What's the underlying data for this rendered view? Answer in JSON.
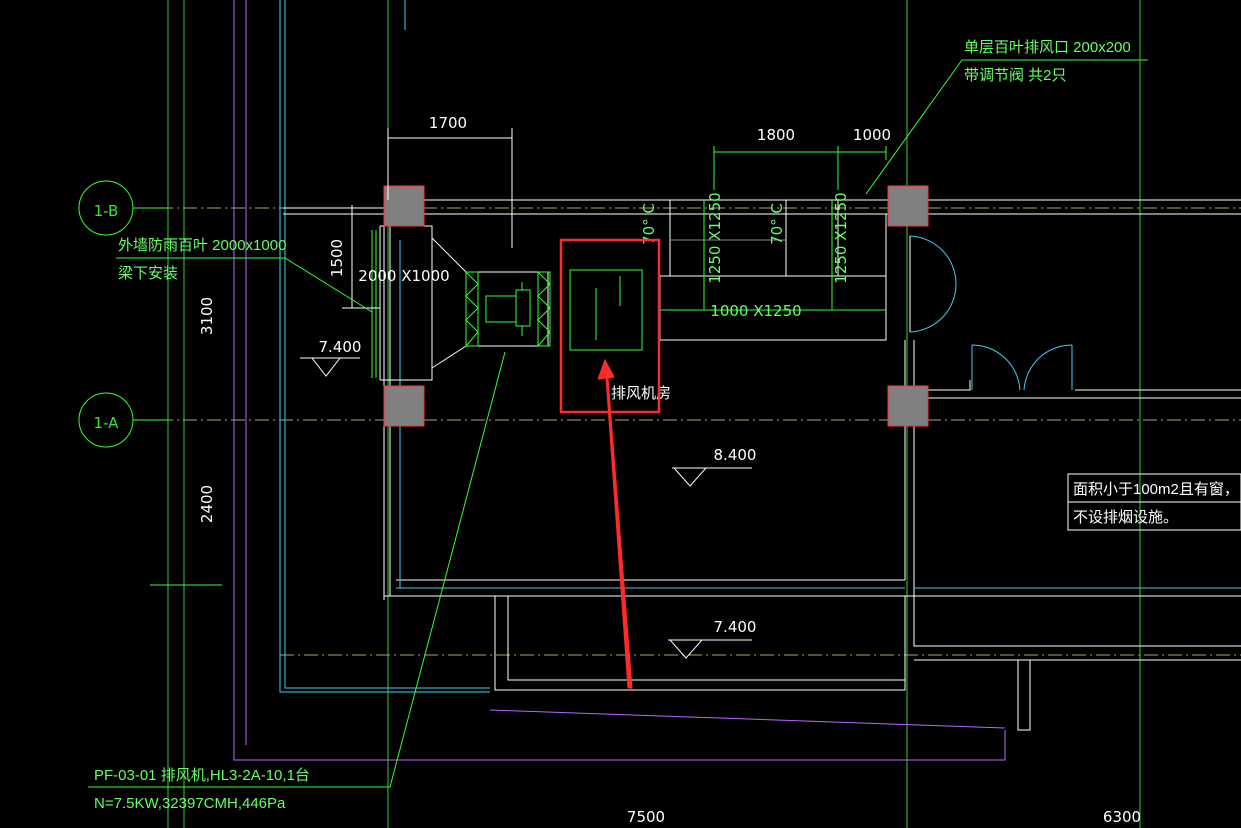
{
  "colors": {
    "background": "#000000",
    "wall_white": "#ffffff",
    "axis_green": "#33ff33",
    "cyan": "#44ccee",
    "magenta": "#bb66ff",
    "column_fill": "#808080",
    "column_border": "#ff3333",
    "highlight_red": "#ff2a2a"
  },
  "grid_axes": {
    "b": "1-B",
    "a": "1-A"
  },
  "dimensions": {
    "top_1700": "1700",
    "top_1800": "1800",
    "top_1000": "1000",
    "left_1500": "1500",
    "left_3100": "3100",
    "left_2400": "2400",
    "bottom_7500": "7500",
    "bottom_6300": "6300"
  },
  "duct_labels": {
    "d2000": "2000 X1000",
    "d1000": "1000 X1250",
    "v1": "1250 X1250",
    "v2": "1250 X1250",
    "deg1": "70° C",
    "deg2": "70° C"
  },
  "notes": {
    "louver_line1": "单层百叶排风口 200x200",
    "louver_line2": "带调节阀 共2只",
    "wall_line1": "外墙防雨百叶 2000x1000",
    "wall_line2": "梁下安装",
    "room": "排风机房",
    "smoke_line1": "面积小于100m2且有窗，",
    "smoke_line2": "不设排烟设施。",
    "equip_line1": "PF-03-01 排风机,HL3-2A-10,1台",
    "equip_line2": "N=7.5KW,32397CMH,446Pa"
  },
  "elevations": {
    "e1": "7.400",
    "e2": "8.400",
    "e3": "7.400"
  }
}
